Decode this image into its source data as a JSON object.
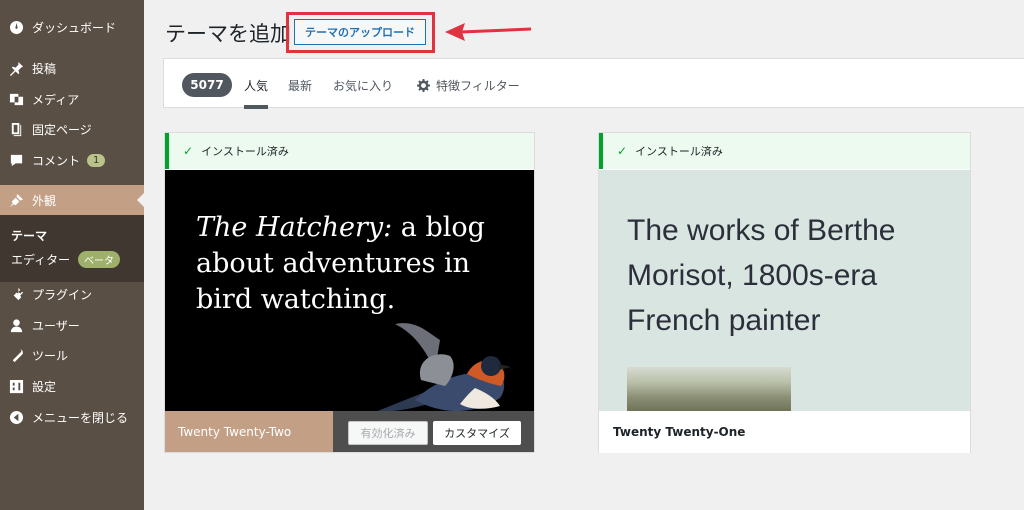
{
  "sidebar": {
    "items": [
      {
        "label": "ダッシュボード",
        "icon": "dashboard-icon"
      },
      {
        "label": "投稿",
        "icon": "pin-icon"
      },
      {
        "label": "メディア",
        "icon": "media-icon"
      },
      {
        "label": "固定ページ",
        "icon": "page-icon"
      },
      {
        "label": "コメント",
        "icon": "comment-icon",
        "badge": "1"
      },
      {
        "label": "外観",
        "icon": "appearance-icon"
      },
      {
        "label": "プラグイン",
        "icon": "plugin-icon"
      },
      {
        "label": "ユーザー",
        "icon": "user-icon"
      },
      {
        "label": "ツール",
        "icon": "wrench-icon"
      },
      {
        "label": "設定",
        "icon": "settings-icon"
      },
      {
        "label": "メニューを閉じる",
        "icon": "collapse-icon"
      }
    ],
    "submenu": {
      "themes": "テーマ",
      "editor": "エディター",
      "beta": "ベータ"
    }
  },
  "header": {
    "title": "テーマを追加",
    "upload_button": "テーマのアップロード"
  },
  "filter": {
    "count": "5077",
    "tabs": [
      "人気",
      "最新",
      "お気に入り"
    ],
    "feature_filter": "特徴フィルター"
  },
  "themes": [
    {
      "installed": "インストール済み",
      "preview_italic": "The Hatchery:",
      "preview_rest": " a blog about adventures in bird watching.",
      "name": "Twenty Twenty-Two",
      "activated": "有効化済み",
      "customize": "カスタマイズ"
    },
    {
      "installed": "インストール済み",
      "preview_text": "The works of Berthe Morisot, 1800s-era French painter",
      "name": "Twenty Twenty-One"
    }
  ],
  "colors": {
    "sidebar": "#5a4f45",
    "accent": "#c3a085",
    "highlight": "#e03340"
  }
}
